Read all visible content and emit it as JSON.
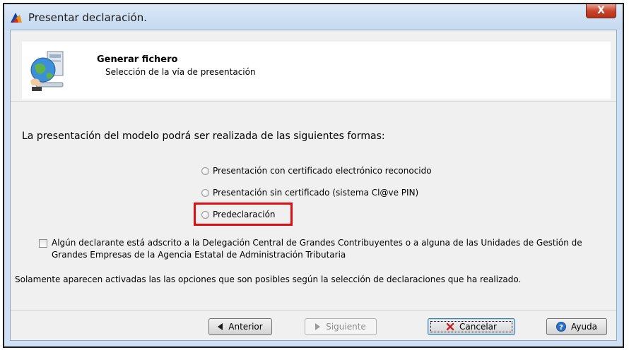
{
  "window": {
    "title": "Presentar declaración.",
    "close_label": "X"
  },
  "header": {
    "title": "Generar fichero",
    "subtitle": "Selección de la vía de presentación"
  },
  "main": {
    "intro": "La presentación del modelo podrá ser realizada de las siguientes formas:",
    "options": [
      {
        "label": "Presentación con certificado electrónico reconocido",
        "selected": false
      },
      {
        "label": "Presentación sin certificado (sistema Cl@ve PIN)",
        "selected": false
      },
      {
        "label": "Predeclaración",
        "selected": false,
        "highlighted": true
      }
    ],
    "checkbox": {
      "label": "Algún declarante está adscrito a la Delegación Central de Grandes Contribuyentes o a alguna de las Unidades de Gestión de Grandes Empresas de la Agencia Estatal de Administración Tributaria",
      "checked": false
    },
    "footnote": "Solamente aparecen activadas las las opciones que son posibles según la selección de declaraciones que ha realizado."
  },
  "buttons": {
    "back": "Anterior",
    "next": "Siguiente",
    "cancel": "Cancelar",
    "help": "Ayuda"
  },
  "colors": {
    "highlight": "#e00d12",
    "window_frame": "#cfe0f4",
    "close_button": "#c8452d"
  },
  "icons": {
    "title": "aeat-logo-icon",
    "header": "globe-computer-icon",
    "back": "arrow-left-icon",
    "next": "arrow-right-icon",
    "cancel": "cancel-x-icon",
    "help": "help-icon"
  }
}
